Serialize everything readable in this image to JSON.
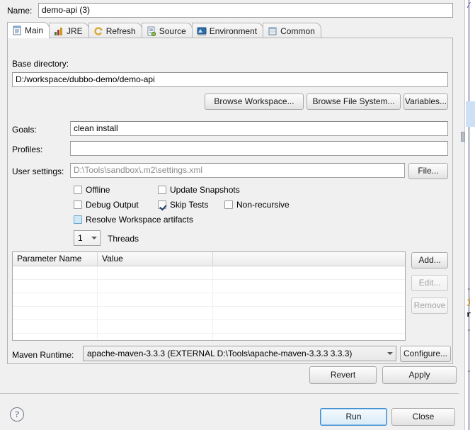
{
  "dialog": {
    "name_label": "Name:",
    "name_value": "demo-api (3)"
  },
  "tabs": [
    {
      "label": "Main",
      "icon": "document-icon",
      "active": true,
      "name": "tab-main"
    },
    {
      "label": "JRE",
      "icon": "jre-icon",
      "active": false,
      "name": "tab-jre"
    },
    {
      "label": "Refresh",
      "icon": "refresh-icon",
      "active": false,
      "name": "tab-refresh"
    },
    {
      "label": "Source",
      "icon": "source-icon",
      "active": false,
      "name": "tab-source"
    },
    {
      "label": "Environment",
      "icon": "environment-icon",
      "active": false,
      "name": "tab-environment"
    },
    {
      "label": "Common",
      "icon": "common-icon",
      "active": false,
      "name": "tab-common"
    }
  ],
  "main": {
    "base_directory_label": "Base directory:",
    "base_directory_value": "D:/workspace/dubbo-demo/demo-api",
    "browse_workspace_label": "Browse Workspace...",
    "browse_filesystem_label": "Browse File System...",
    "variables_label": "Variables...",
    "goals_label": "Goals:",
    "goals_value": "clean install",
    "profiles_label": "Profiles:",
    "profiles_value": "",
    "user_settings_label": "User settings:",
    "user_settings_value": "D:\\Tools\\sandbox\\.m2\\settings.xml",
    "file_button_label": "File...",
    "checkboxes": [
      {
        "label": "Offline",
        "checked": false,
        "hover": false,
        "name": "checkbox-offline"
      },
      {
        "label": "Update Snapshots",
        "checked": false,
        "hover": false,
        "name": "checkbox-update-snapshots"
      },
      {
        "label": "Debug Output",
        "checked": false,
        "hover": false,
        "name": "checkbox-debug-output"
      },
      {
        "label": "Skip Tests",
        "checked": true,
        "hover": false,
        "name": "checkbox-skip-tests"
      },
      {
        "label": "Non-recursive",
        "checked": false,
        "hover": false,
        "name": "checkbox-non-recursive"
      },
      {
        "label": "Resolve Workspace artifacts",
        "checked": false,
        "hover": true,
        "name": "checkbox-resolve-workspace-artifacts"
      }
    ],
    "threads_value": "1",
    "threads_label": "Threads",
    "table": {
      "columns": [
        "Parameter Name",
        "Value",
        ""
      ],
      "rows": [],
      "empty_row_count": 6
    },
    "add_label": "Add...",
    "edit_label": "Edit...",
    "remove_label": "Remove",
    "maven_runtime_label": "Maven Runtime:",
    "maven_runtime_value": "apache-maven-3.3.3 (EXTERNAL D:\\Tools\\apache-maven-3.3.3 3.3.3)",
    "configure_label": "Configure..."
  },
  "footer": {
    "revert_label": "Revert",
    "apply_label": "Apply",
    "help_icon": "help-icon",
    "help_glyph": "?",
    "run_label": "Run",
    "close_label": "Close"
  },
  "colors": {
    "dialog_bg": "#f0f0f0",
    "field_bg": "#ffffff",
    "accent_focus": "#3c8bd0",
    "hover_blue": "#cfe8f7",
    "disabled_text": "#a3a3a3"
  },
  "background_window": {
    "code_fragments": [
      "/",
      "j",
      "r",
      "-",
      "-",
      "-"
    ]
  }
}
